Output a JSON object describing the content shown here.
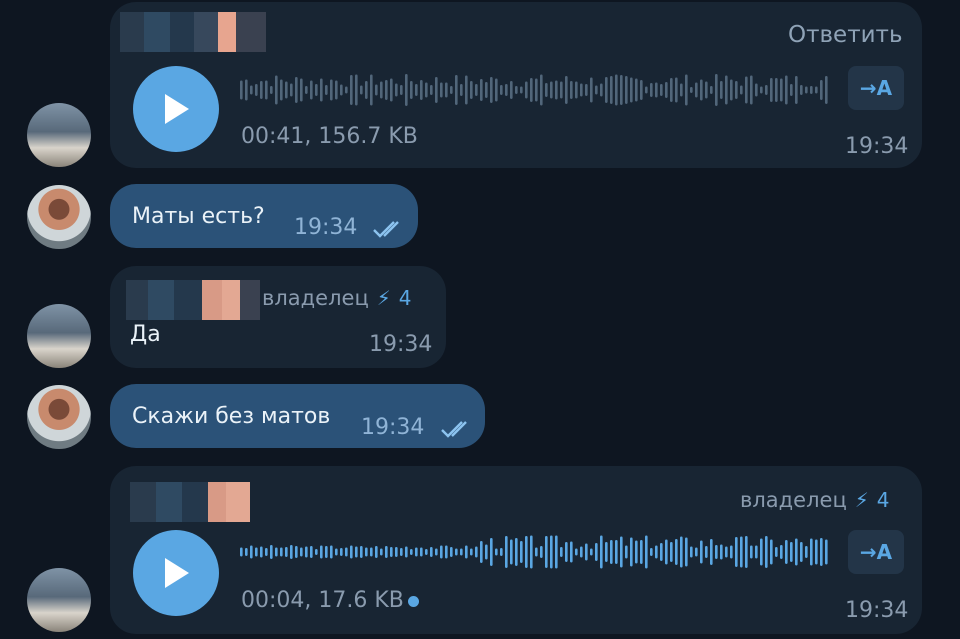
{
  "messages": [
    {
      "kind": "voice",
      "reply_label": "Ответить",
      "duration_size": "00:41, 156.7 KB",
      "time": "19:34",
      "translate_label": "→A"
    },
    {
      "kind": "text_out",
      "text": "Маты есть?",
      "time": "19:34"
    },
    {
      "kind": "text_in",
      "role": "владелец",
      "boost_count": "4",
      "text": "Да",
      "time": "19:34"
    },
    {
      "kind": "text_out",
      "text": "Скажи без матов",
      "time": "19:34"
    },
    {
      "kind": "voice",
      "role": "владелец",
      "boost_count": "4",
      "duration_size": "00:04, 17.6 KB",
      "time": "19:34",
      "translate_label": "→A"
    }
  ],
  "colors": {
    "background": "#0e1621",
    "incoming_bubble": "#182533",
    "outgoing_bubble": "#2b5278",
    "accent": "#5aa7e3"
  }
}
